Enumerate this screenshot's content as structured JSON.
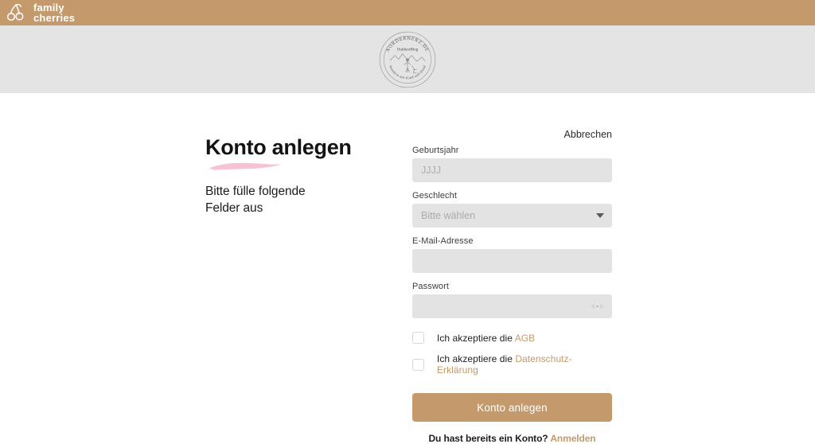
{
  "topbar": {
    "brand_line1": "family",
    "brand_line2": "cherries",
    "logo_icon": "cherries-icon",
    "background_color": "#c49a6c"
  },
  "seal": {
    "arc_top_text": "NORDERHERZ.DE",
    "center_text": "OutdoorBlog",
    "arc_bottom_text": "Wandern mit Kind und Hund",
    "illustration": "hiker-with-dog-and-mountains",
    "band_color": "#e4e4e4"
  },
  "left": {
    "headline": "Konto anlegen",
    "underline_color": "#f7c3d3",
    "subline_line1": "Bitte fülle folgende",
    "subline_line2": "Felder aus"
  },
  "form": {
    "cancel_label": "Abbrechen",
    "fields": [
      {
        "label": "Geburtsjahr",
        "placeholder": "JJJJ",
        "value": "",
        "type": "text"
      },
      {
        "label": "Geschlecht",
        "placeholder": "Bitte wählen",
        "value": "Bitte wählen",
        "type": "select"
      },
      {
        "label": "E-Mail-Adresse",
        "placeholder": "",
        "value": "",
        "type": "email"
      },
      {
        "label": "Passwort",
        "placeholder": "",
        "value": "",
        "type": "password"
      }
    ],
    "gender_options": [
      "Bitte wählen"
    ],
    "checkboxes": [
      {
        "prefix": "Ich akzeptiere die ",
        "link": "AGB",
        "checked": false
      },
      {
        "prefix": "Ich akzeptiere die ",
        "link": "Datenschutz-Erklärung",
        "checked": false
      }
    ],
    "submit_label": "Konto anlegen",
    "submit_color": "#c49a6c",
    "footer_prefix": "Du hast bereits ein Konto? ",
    "footer_link": "Anmelden",
    "link_color": "#c49a6c",
    "password_toggle_icon": "eye-icon",
    "select_caret_icon": "chevron-down-icon"
  }
}
